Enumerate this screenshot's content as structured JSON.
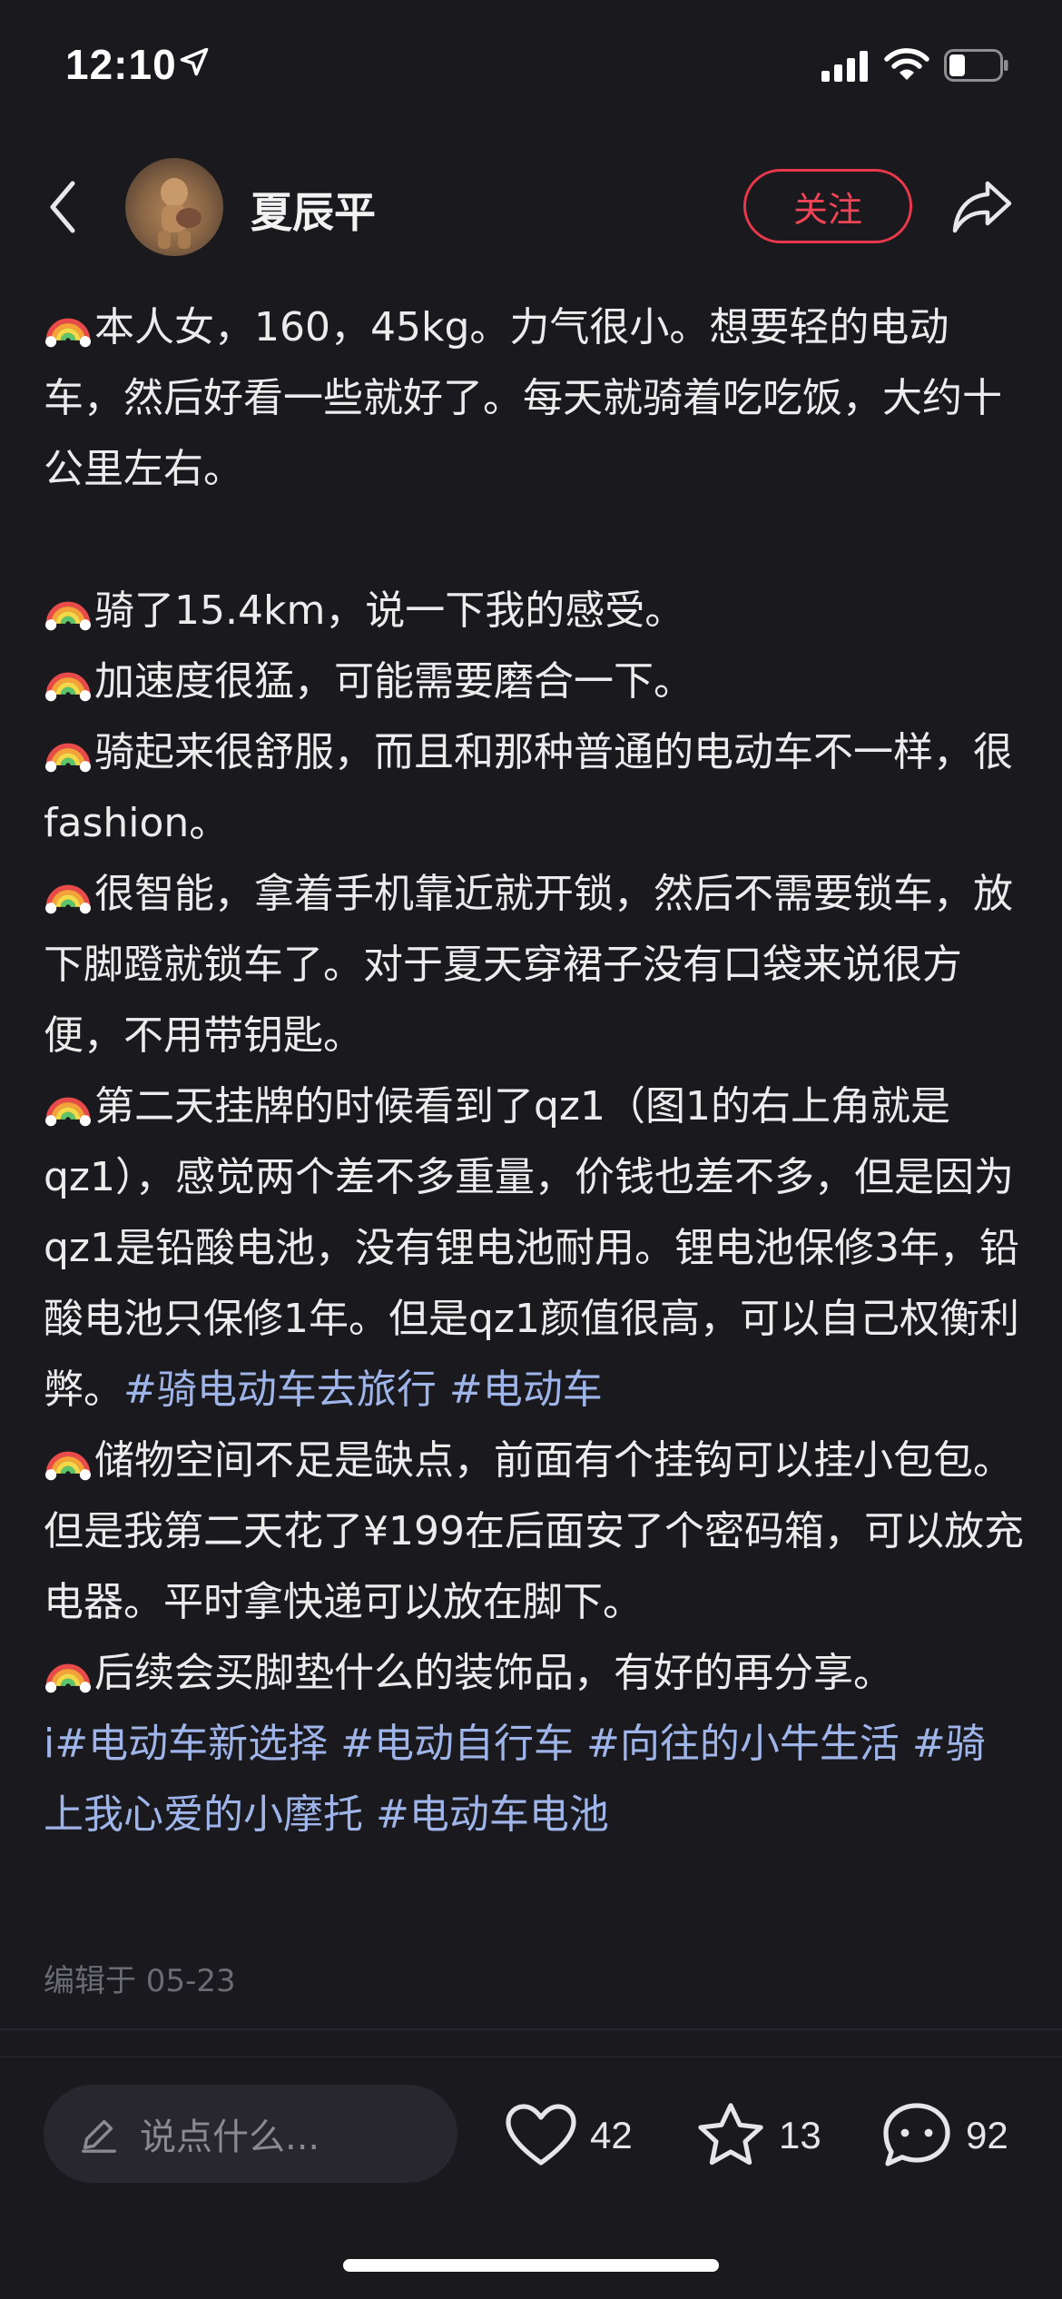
{
  "status_bar": {
    "time": "12:10",
    "icons": [
      "location-arrow-icon",
      "cellular-signal-icon",
      "wifi-icon",
      "battery-icon"
    ]
  },
  "header": {
    "username": "夏辰平",
    "follow_label": "关注",
    "icons": [
      "back-chevron-icon",
      "share-arrow-icon"
    ]
  },
  "post": {
    "emoji_icon": "rainbow-emoji",
    "paragraphs": [
      {
        "emoji": true,
        "text": "本人女，160，45kg。力气很小。想要轻的电动车，然后好看一些就好了。每天就骑着吃吃饭，大约十公里左右。"
      },
      {
        "emoji": true,
        "text": "骑了15.4km，说一下我的感受。"
      },
      {
        "emoji": true,
        "text": "加速度很猛，可能需要磨合一下。"
      },
      {
        "emoji": true,
        "text": "骑起来很舒服，而且和那种普通的电动车不一样，很fashion。"
      },
      {
        "emoji": true,
        "text": "很智能，拿着手机靠近就开锁，然后不需要锁车，放下脚蹬就锁车了。对于夏天穿裙子没有口袋来说很方便，不用带钥匙。"
      },
      {
        "emoji": true,
        "text": "第二天挂牌的时候看到了qz1（图1的右上角就是qz1），感觉两个差不多重量，价钱也差不多，但是因为qz1是铅酸电池，没有锂电池耐用。锂电池保修3年，铅酸电池只保修1年。但是qz1颜值很高，可以自己权衡利弊。"
      },
      {
        "emoji": true,
        "text": "储物空间不足是缺点，前面有个挂钩可以挂小包包。但是我第二天花了¥199在后面安了个密码箱，可以放充电器。平时拿快递可以放在脚下。"
      },
      {
        "emoji": true,
        "text": "后续会买脚垫什么的装饰品，有好的再分享。"
      }
    ],
    "inline_tags": [
      "#骑电动车去旅行",
      "#电动车"
    ],
    "trailing_tags": [
      "i#电动车新选择",
      "#电动自行车",
      "#向往的小牛生活",
      "#骑上我心爱的小摩托",
      "#电动车电池"
    ],
    "edit_date": "编辑于 05-23"
  },
  "bottom_bar": {
    "comment_placeholder": "说点什么...",
    "like_count": "42",
    "star_count": "13",
    "comment_count": "92",
    "icons": [
      "pencil-icon",
      "heart-icon",
      "star-icon",
      "chat-bubble-icon"
    ]
  },
  "colors": {
    "background": "#19191e",
    "text": "#ececed",
    "hashtag": "#9fb5ea",
    "follow_red": "#e8384b",
    "muted": "#6b6b72"
  }
}
